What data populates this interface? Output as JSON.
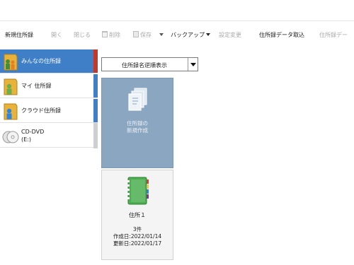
{
  "toolbar": {
    "new_book": "新規住所録",
    "open": "開く",
    "close": "閉じる",
    "delete": "削除",
    "save": "保存",
    "backup": "バックアップ",
    "settings": "設定変更",
    "import": "住所録データ取込",
    "export_partial": "住所録デー"
  },
  "sidebar": {
    "items": [
      {
        "label": "みんなの住所録",
        "accent": "#c0392b"
      },
      {
        "label": "マイ 住所録",
        "accent": "#3f7fc8"
      },
      {
        "label": "クラウド住所録",
        "accent": "#3f7fc8"
      },
      {
        "label": "CD-DVD",
        "sub": "(E:)",
        "accent": "#c8c8c8"
      }
    ]
  },
  "sort": {
    "value": "住所録名逆順表示"
  },
  "cards": {
    "new": {
      "line1": "住所録の",
      "line2": "新規作成"
    },
    "book": {
      "name": "住所１",
      "count": "3件",
      "created": "作成日:2022/01/14",
      "updated": "更新日:2022/01/17"
    }
  },
  "colors": {
    "selected_bg": "#3f7fc8",
    "new_card_bg": "#8ba6c0",
    "book_green": "#4caf50"
  }
}
